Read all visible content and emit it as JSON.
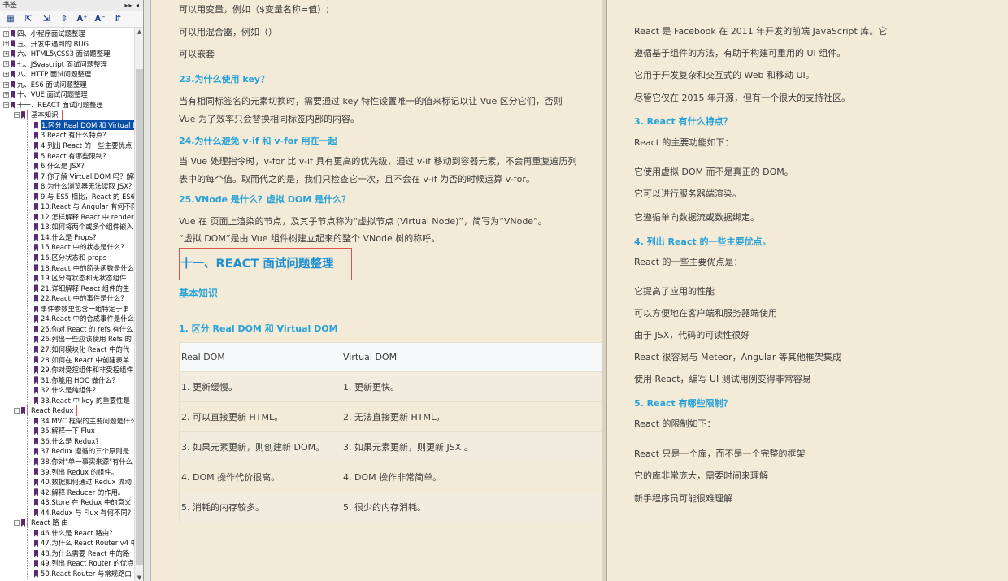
{
  "sidebar": {
    "title": "书签",
    "title_controls": "▸▸ ◂",
    "toolbar": [
      {
        "name": "outline-view-icon",
        "glyph": "▦"
      },
      {
        "name": "bookmark-jump-icon",
        "glyph": "⇱"
      },
      {
        "name": "bookmark-add-icon",
        "glyph": "⇲"
      },
      {
        "name": "bookmark-properties-icon",
        "glyph": "⇳"
      },
      {
        "name": "font-increase-icon",
        "glyph": "A⁺"
      },
      {
        "name": "font-decrease-icon",
        "glyph": "A⁻"
      },
      {
        "name": "bookmark-expand-icon",
        "glyph": "⇵"
      }
    ],
    "top_items": [
      "四、小程序面试题整理",
      "五、开发中遇到的 BUG",
      "六、HTML5\\CSS3 面试题整理",
      "七、JSvascript 面试问题整理",
      "八、HTTP 面试问题整理",
      "九、ES6 面试问题整理",
      "十、VUE 面试问题整理",
      "十一、REACT 面试问题整理"
    ],
    "groups": [
      {
        "label": "基本知识",
        "items": [
          "1.区分 Real DOM 和 Virtual DOM",
          "3.React 有什么特点？",
          "4.列出 React 的一些主要优点",
          "5.React 有哪些限制？",
          "6.什么是 JSX？",
          "7.你了解 Virtual DOM 吗？解释",
          "8.为什么浏览器无法读取 JSX？",
          "9.与 ES5 相比，React 的 ES6",
          "10.React 与 Angular 有何不同",
          "12.怎样解释 React 中 render",
          "13.如何将两个或多个组件嵌入",
          "14.什么是 Props?",
          "15.React 中的状态是什么？",
          "16.区分状态和 props",
          "18.React 中的箭头函数是什么",
          "19.区分有状态和无状态组件",
          "21.详细解释 React 组件的生",
          "22.React 中的事件是什么？",
          "事件参数里包含一组特定于事",
          "24.React 中的合成事件是什么",
          "25.你对 React 的 refs 有什么",
          "26.列出一些应该使用 Refs 的",
          "27.如何模块化 React 中的代",
          "28.如何在 React 中创建表单",
          "29.你对受控组件和非受控组件",
          "31.你能用 HOC 做什么？",
          "32.什么是纯组件？",
          "33.React 中 key 的重要性是"
        ]
      },
      {
        "label": "React Redux",
        "items": [
          "34.MVC 框架的主要问题是什么",
          "35.解释一下 Flux",
          "36.什么是 Redux?",
          "37.Redux 遵循的三个原则是",
          "38.你对\"单一事实来源\"有什么",
          "39.列出 Redux 的组件。",
          "40.数据如何通过 Redux 流动",
          "42.解释 Reducer 的作用。",
          "43.Store 在 Redux 中的意义",
          "44.Redux 与 Flux 有何不同?"
        ]
      },
      {
        "label": "React 路 由",
        "items": [
          "46.什么是 React 路由?",
          "47.为什么 React Router v4 中",
          "48.为什么需要 React 中的路",
          "49.列出 React Router 的优点",
          "50.React Router 与常规路由"
        ]
      }
    ]
  },
  "left_page": {
    "line1": "可以用变量，例如（$变量名称=值）;",
    "line2": "可以用混合器，例如（）",
    "line3": "可以嵌套",
    "q23": "23.为什么使用 key？",
    "q23_body": "当有相同标签名的元素切换时，需要通过 key 特性设置唯一的值来标记以让 Vue 区分它们，否则 Vue 为了效率只会替换相同标签内部的内容。",
    "q24": "24.为什么避免 v-if 和  v-for 用在一起",
    "q24_body": "当 Vue 处理指令时，v-for 比 v-if 具有更高的优先级，通过 v-if 移动到容器元素，不会再重复遍历列表中的每个值。取而代之的是，我们只检查它一次，且不会在 v-if 为否的时候运算 v-for。",
    "q25": "25.VNode 是什么？虚拟 DOM 是什么？",
    "q25_body1": "Vue 在 页面上渲染的节点，及其子节点称为“虚拟节点 (Virtual Node)”，简写为“VNode”。",
    "q25_body2": "“虚拟 DOM”是由 Vue 组件树建立起来的整个 VNode 树的称呼。",
    "chapter": "十一、REACT 面试问题整理",
    "section": "基本知识",
    "q1": "1.  区分 Real DOM 和 Virtual DOM",
    "table": {
      "headers": [
        "Real DOM",
        "Virtual DOM"
      ],
      "rows": [
        [
          "1. 更新缓慢。",
          "1. 更新更快。"
        ],
        [
          "2. 可以直接更新 HTML。",
          "2. 无法直接更新 HTML。"
        ],
        [
          "3. 如果元素更新，则创建新 DOM。",
          "3. 如果元素更新，则更新 JSX 。"
        ],
        [
          "4. DOM 操作代价很高。",
          "4. DOM 操作非常简单。"
        ],
        [
          "5. 消耗的内存较多。",
          "5. 很少的内存消耗。"
        ]
      ]
    }
  },
  "right_page": {
    "p1": "React 是 Facebook 在 2011 年开发的前端 JavaScript 库。它",
    "p2": "遵循基于组件的方法，有助于构建可重用的 UI 组件。",
    "p3": "它用于开发复杂和交互式的 Web 和移动 UI。",
    "p4": "尽管它仅在 2015 年开源，但有一个很大的支持社区。",
    "q3": "3. React 有什么特点？",
    "q3_intro": "React 的主要功能如下：",
    "q3_items": [
      "它使用虚拟 DOM 而不是真正的 DOM。",
      "它可以进行服务器端渲染。",
      "它遵循单向数据流或数据绑定。"
    ],
    "q4": "4.  列出 React 的一些主要优点。",
    "q4_intro": "React 的一些主要优点是：",
    "q4_items": [
      "它提高了应用的性能",
      "可以方便地在客户端和服务器端使用",
      "由于 JSX，代码的可读性很好",
      "React 很容易与 Meteor，Angular 等其他框架集成",
      "使用 React，编写 UI 测试用例变得非常容易"
    ],
    "q5": "5. React 有哪些限制？",
    "q5_intro": "React 的限制如下：",
    "q5_items": [
      "React 只是一个库，而不是一个完整的框架",
      "它的库非常庞大，需要时间来理解",
      "新手程序员可能很难理解"
    ]
  }
}
